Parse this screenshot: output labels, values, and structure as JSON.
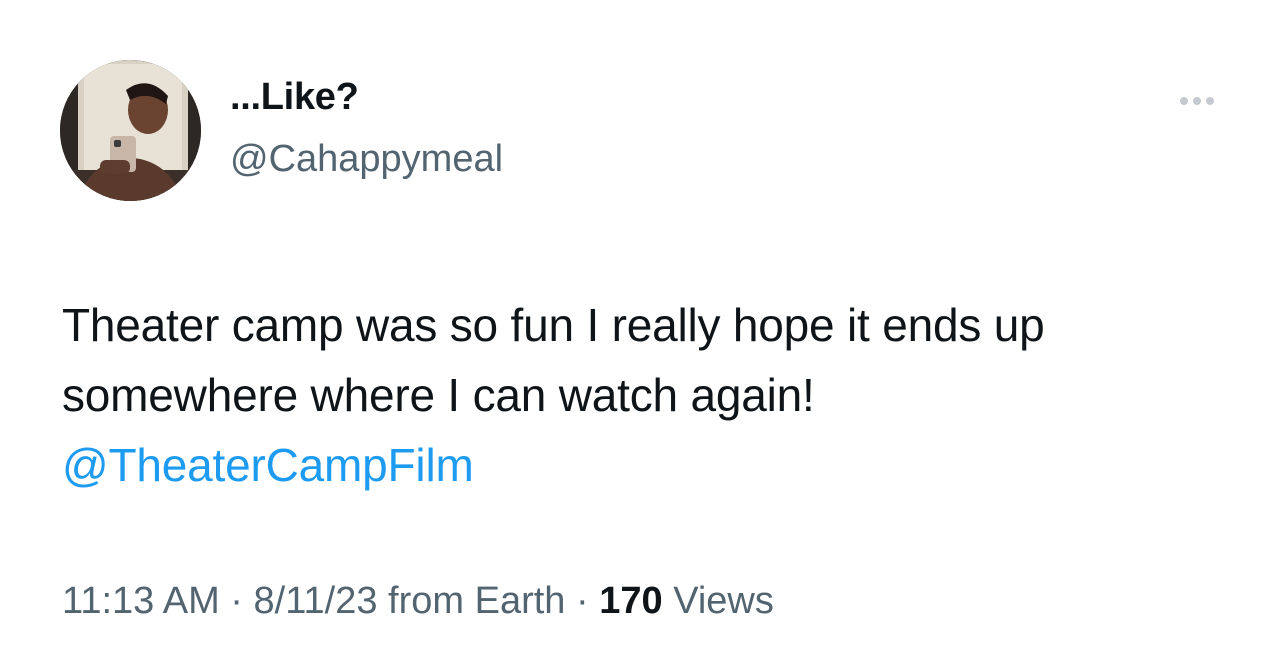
{
  "tweet": {
    "display_name": "...Like?",
    "handle": "@Cahappymeal",
    "text_line1": "Theater camp was so fun I really hope it ends up",
    "text_line2": "somewhere where I can watch again!",
    "mention": "@TheaterCampFilm",
    "time": "11:13 AM",
    "separator": "·",
    "date": "8/11/23",
    "source": "from Earth",
    "views_count": "170",
    "views_label": "Views"
  },
  "icons": {
    "more": "more-horizontal-icon",
    "avatar": "profile-photo"
  },
  "colors": {
    "text": "#0f1419",
    "secondary": "#536471",
    "link": "#1d9bf0",
    "more_dots": "#c4cad0"
  }
}
